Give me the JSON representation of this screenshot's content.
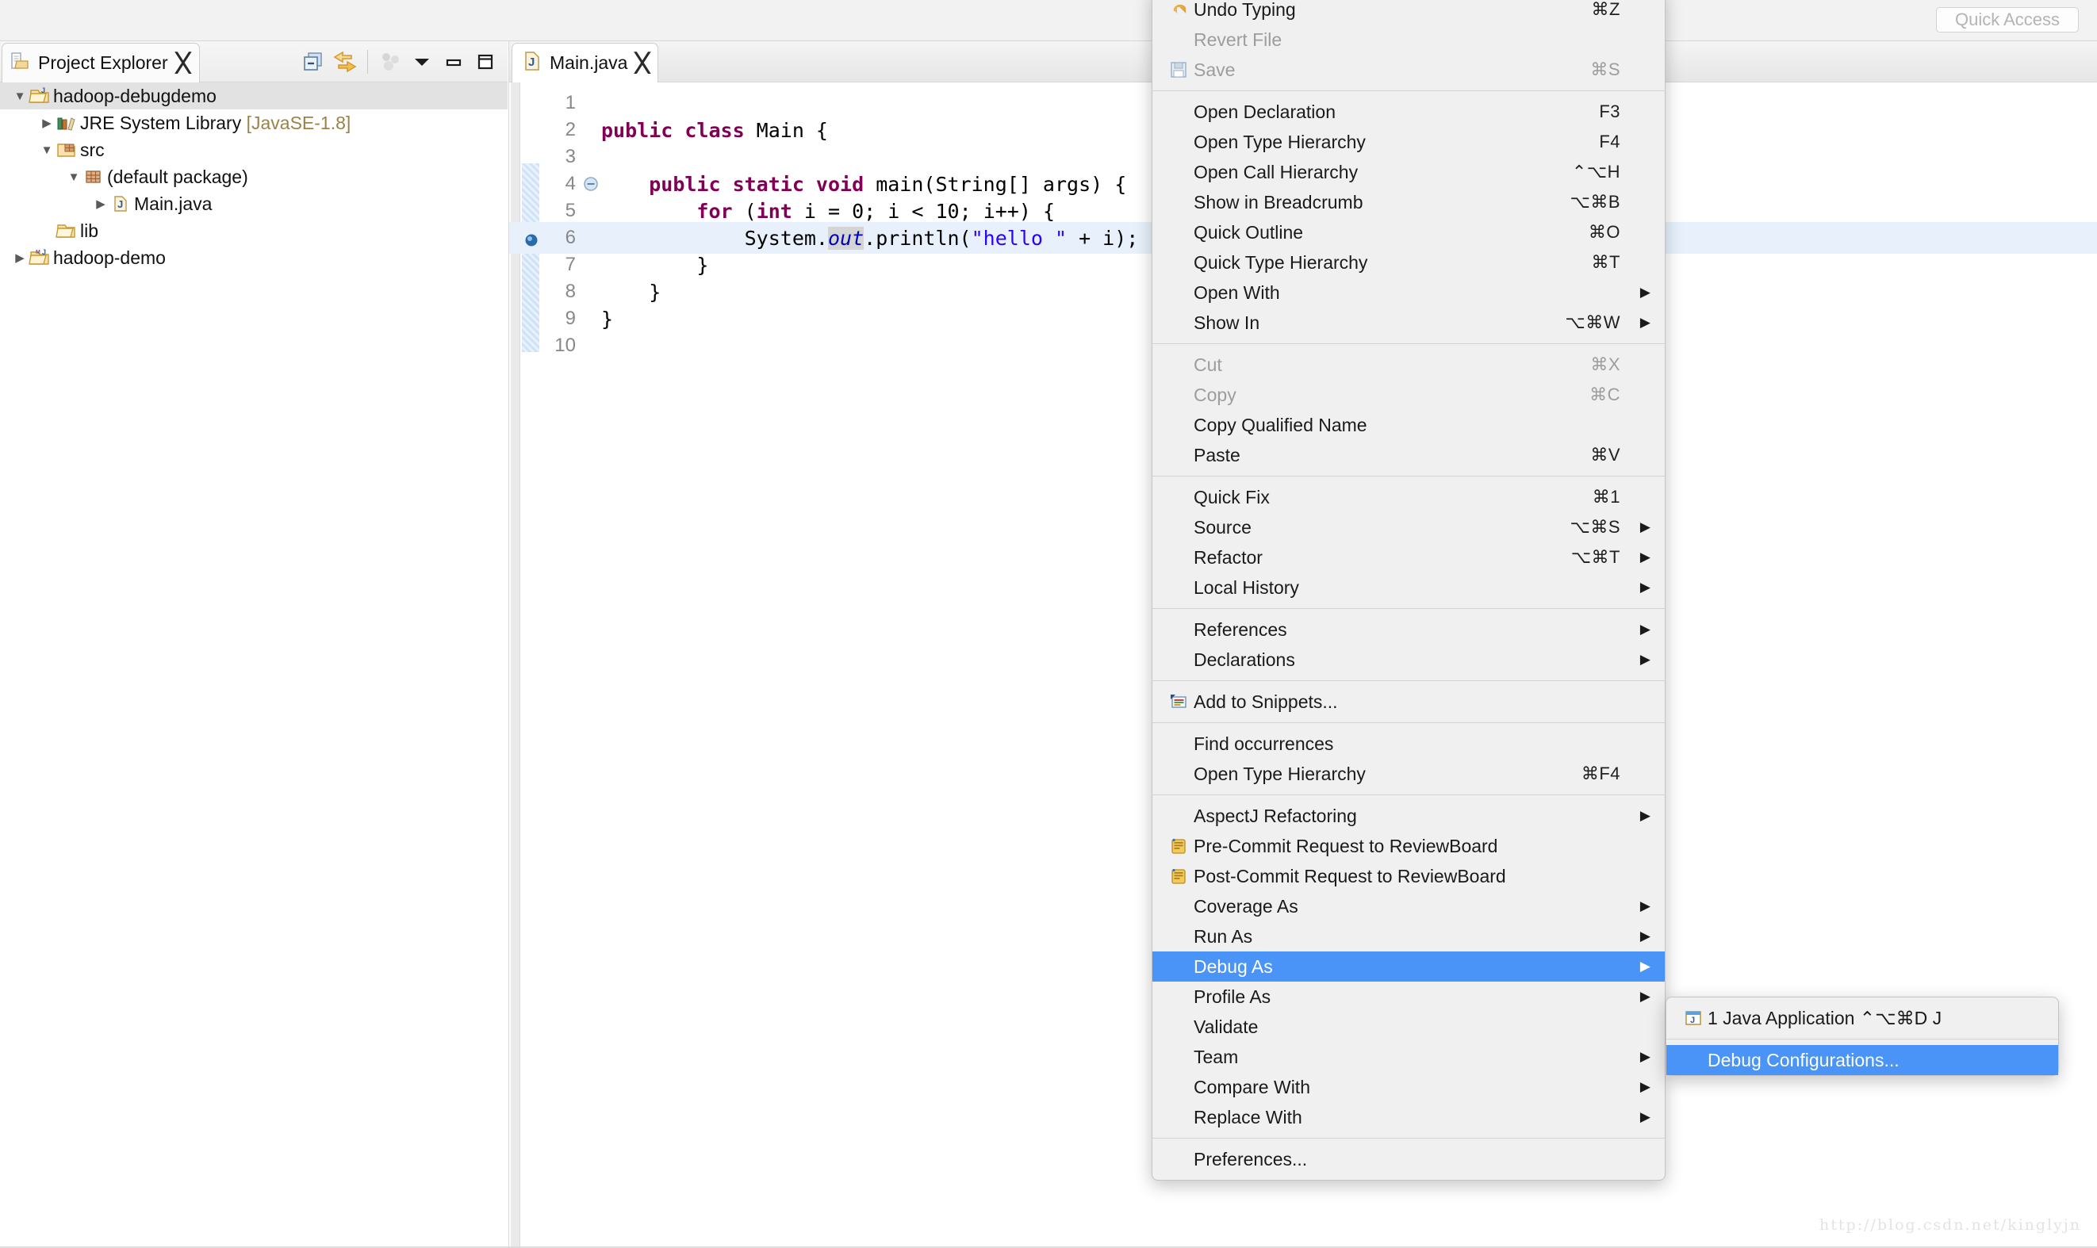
{
  "window": {
    "quick_access_label": "Quick Access",
    "watermark": "http://blog.csdn.net/kinglyjn",
    "accent_highlight": "#4a94f7",
    "menu_background": "#f0f0f0",
    "tree_selection": "#e2e2e2"
  },
  "project_explorer": {
    "tab_title": "Project Explorer",
    "toolbar": [
      {
        "name": "collapse-all-icon",
        "label": "Collapse All"
      },
      {
        "name": "link-with-editor-icon",
        "label": "Link with Editor"
      },
      {
        "name": "view-menu-icon",
        "label": "View Menu"
      },
      {
        "name": "chevron-down-icon",
        "label": "View Menu"
      },
      {
        "name": "minimize-icon",
        "label": "Minimize"
      },
      {
        "name": "maximize-icon",
        "label": "Maximize"
      }
    ],
    "tree": [
      {
        "label": "hadoop-debugdemo",
        "suffix": "",
        "indent": 0,
        "twist": "open",
        "icon": "java-project-icon",
        "selected": true
      },
      {
        "label": "JRE System Library",
        "suffix": " [JavaSE-1.8]",
        "indent": 1,
        "twist": "closed",
        "icon": "library-icon",
        "selected": false
      },
      {
        "label": "src",
        "suffix": "",
        "indent": 1,
        "twist": "open",
        "icon": "source-folder-icon",
        "selected": false
      },
      {
        "label": "(default package)",
        "suffix": "",
        "indent": 2,
        "twist": "open",
        "icon": "package-icon",
        "selected": false
      },
      {
        "label": "Main.java",
        "suffix": "",
        "indent": 3,
        "twist": "closed",
        "icon": "java-file-icon",
        "selected": false
      },
      {
        "label": "lib",
        "suffix": "",
        "indent": 1,
        "twist": "none",
        "icon": "folder-icon",
        "selected": false
      },
      {
        "label": "hadoop-demo",
        "suffix": "",
        "indent": 0,
        "twist": "closed",
        "icon": "maven-project-icon",
        "selected": false
      }
    ]
  },
  "editor": {
    "tab_title": "Main.java",
    "tab_icon": "java-file-icon",
    "breakpoint_line": 6,
    "highlighted_line": 6,
    "fold_line": 4,
    "lines": [
      {
        "n": "1",
        "text": ""
      },
      {
        "n": "2",
        "text": "public class Main {"
      },
      {
        "n": "3",
        "text": ""
      },
      {
        "n": "4",
        "text": "    public static void main(String[] args) {"
      },
      {
        "n": "5",
        "text": "        for (int i = 0; i < 10; i++) {"
      },
      {
        "n": "6",
        "text": "            System.out.println(\"hello \" + i);"
      },
      {
        "n": "7",
        "text": "        }"
      },
      {
        "n": "8",
        "text": "    }"
      },
      {
        "n": "9",
        "text": "}"
      },
      {
        "n": "10",
        "text": ""
      }
    ]
  },
  "context_menu": {
    "groups": [
      {
        "items": [
          {
            "label": "Undo Typing",
            "shortcut": "⌘Z",
            "icon": "undo-icon",
            "arrow": false,
            "disabled": false,
            "highlighted": false
          },
          {
            "label": "Revert File",
            "shortcut": "",
            "icon": "",
            "arrow": false,
            "disabled": true,
            "highlighted": false
          },
          {
            "label": "Save",
            "shortcut": "⌘S",
            "icon": "save-icon",
            "arrow": false,
            "disabled": true,
            "highlighted": false
          }
        ]
      },
      {
        "items": [
          {
            "label": "Open Declaration",
            "shortcut": "F3",
            "icon": "",
            "arrow": false,
            "disabled": false,
            "highlighted": false
          },
          {
            "label": "Open Type Hierarchy",
            "shortcut": "F4",
            "icon": "",
            "arrow": false,
            "disabled": false,
            "highlighted": false
          },
          {
            "label": "Open Call Hierarchy",
            "shortcut": "⌃⌥H",
            "icon": "",
            "arrow": false,
            "disabled": false,
            "highlighted": false
          },
          {
            "label": "Show in Breadcrumb",
            "shortcut": "⌥⌘B",
            "icon": "",
            "arrow": false,
            "disabled": false,
            "highlighted": false
          },
          {
            "label": "Quick Outline",
            "shortcut": "⌘O",
            "icon": "",
            "arrow": false,
            "disabled": false,
            "highlighted": false
          },
          {
            "label": "Quick Type Hierarchy",
            "shortcut": "⌘T",
            "icon": "",
            "arrow": false,
            "disabled": false,
            "highlighted": false
          },
          {
            "label": "Open With",
            "shortcut": "",
            "icon": "",
            "arrow": true,
            "disabled": false,
            "highlighted": false
          },
          {
            "label": "Show In",
            "shortcut": "⌥⌘W",
            "icon": "",
            "arrow": true,
            "disabled": false,
            "highlighted": false
          }
        ]
      },
      {
        "items": [
          {
            "label": "Cut",
            "shortcut": "⌘X",
            "icon": "",
            "arrow": false,
            "disabled": true,
            "highlighted": false
          },
          {
            "label": "Copy",
            "shortcut": "⌘C",
            "icon": "",
            "arrow": false,
            "disabled": true,
            "highlighted": false
          },
          {
            "label": "Copy Qualified Name",
            "shortcut": "",
            "icon": "",
            "arrow": false,
            "disabled": false,
            "highlighted": false
          },
          {
            "label": "Paste",
            "shortcut": "⌘V",
            "icon": "",
            "arrow": false,
            "disabled": false,
            "highlighted": false
          }
        ]
      },
      {
        "items": [
          {
            "label": "Quick Fix",
            "shortcut": "⌘1",
            "icon": "",
            "arrow": false,
            "disabled": false,
            "highlighted": false
          },
          {
            "label": "Source",
            "shortcut": "⌥⌘S",
            "icon": "",
            "arrow": true,
            "disabled": false,
            "highlighted": false
          },
          {
            "label": "Refactor",
            "shortcut": "⌥⌘T",
            "icon": "",
            "arrow": true,
            "disabled": false,
            "highlighted": false
          },
          {
            "label": "Local History",
            "shortcut": "",
            "icon": "",
            "arrow": true,
            "disabled": false,
            "highlighted": false
          }
        ]
      },
      {
        "items": [
          {
            "label": "References",
            "shortcut": "",
            "icon": "",
            "arrow": true,
            "disabled": false,
            "highlighted": false
          },
          {
            "label": "Declarations",
            "shortcut": "",
            "icon": "",
            "arrow": true,
            "disabled": false,
            "highlighted": false
          }
        ]
      },
      {
        "items": [
          {
            "label": "Add to Snippets...",
            "shortcut": "",
            "icon": "snippets-icon",
            "arrow": false,
            "disabled": false,
            "highlighted": false
          }
        ]
      },
      {
        "items": [
          {
            "label": "Find occurrences",
            "shortcut": "",
            "icon": "",
            "arrow": false,
            "disabled": false,
            "highlighted": false
          },
          {
            "label": "Open Type Hierarchy",
            "shortcut": "⌘F4",
            "icon": "",
            "arrow": false,
            "disabled": false,
            "highlighted": false
          }
        ]
      },
      {
        "items": [
          {
            "label": "AspectJ Refactoring",
            "shortcut": "",
            "icon": "",
            "arrow": true,
            "disabled": false,
            "highlighted": false
          },
          {
            "label": "Pre-Commit Request to ReviewBoard",
            "shortcut": "",
            "icon": "reviewboard-icon",
            "arrow": false,
            "disabled": false,
            "highlighted": false
          },
          {
            "label": "Post-Commit Request to ReviewBoard",
            "shortcut": "",
            "icon": "reviewboard-icon",
            "arrow": false,
            "disabled": false,
            "highlighted": false
          },
          {
            "label": "Coverage As",
            "shortcut": "",
            "icon": "",
            "arrow": true,
            "disabled": false,
            "highlighted": false
          },
          {
            "label": "Run As",
            "shortcut": "",
            "icon": "",
            "arrow": true,
            "disabled": false,
            "highlighted": false
          },
          {
            "label": "Debug As",
            "shortcut": "",
            "icon": "",
            "arrow": true,
            "disabled": false,
            "highlighted": true
          },
          {
            "label": "Profile As",
            "shortcut": "",
            "icon": "",
            "arrow": true,
            "disabled": false,
            "highlighted": false
          },
          {
            "label": "Validate",
            "shortcut": "",
            "icon": "",
            "arrow": false,
            "disabled": false,
            "highlighted": false
          },
          {
            "label": "Team",
            "shortcut": "",
            "icon": "",
            "arrow": true,
            "disabled": false,
            "highlighted": false
          },
          {
            "label": "Compare With",
            "shortcut": "",
            "icon": "",
            "arrow": true,
            "disabled": false,
            "highlighted": false
          },
          {
            "label": "Replace With",
            "shortcut": "",
            "icon": "",
            "arrow": true,
            "disabled": false,
            "highlighted": false
          }
        ]
      },
      {
        "items": [
          {
            "label": "Preferences...",
            "shortcut": "",
            "icon": "",
            "arrow": false,
            "disabled": false,
            "highlighted": false
          }
        ]
      }
    ]
  },
  "debug_as_submenu": {
    "items": [
      {
        "label": "1 Java Application  ⌃⌥⌘D J",
        "icon": "java-application-icon",
        "highlighted": false,
        "separator_after": true
      },
      {
        "label": "Debug Configurations...",
        "icon": "",
        "highlighted": true,
        "separator_after": false
      }
    ]
  }
}
